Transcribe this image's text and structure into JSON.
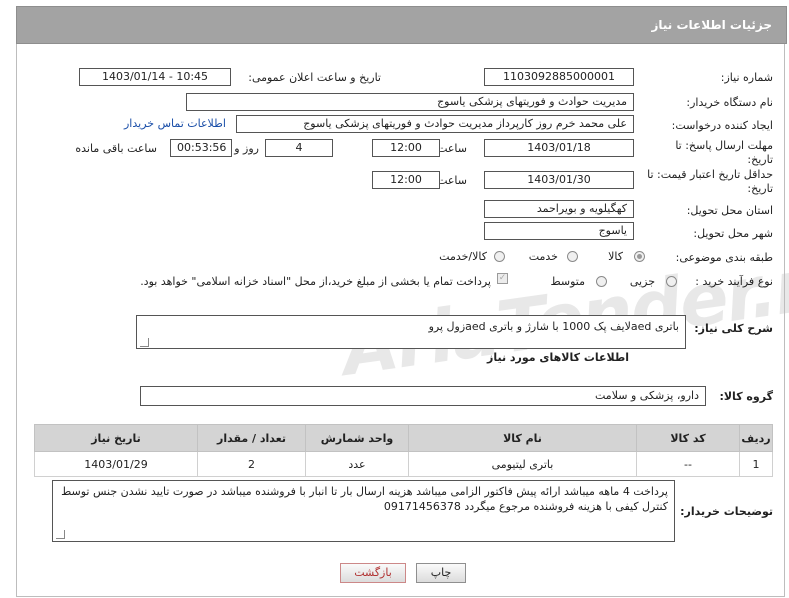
{
  "header": {
    "title": "جزئیات اطلاعات نیاز"
  },
  "form": {
    "need_number_label": "شماره نیاز:",
    "need_number": "1103092885000001",
    "announce_label": "تاریخ و ساعت اعلان عمومی:",
    "announce_value": "1403/01/14 - 10:45",
    "buyer_org_label": "نام دستگاه خریدار:",
    "buyer_org": "مدیریت حوادث و فوریتهای پزشکی یاسوج",
    "creator_label": "ایجاد کننده درخواست:",
    "creator": "علی محمد خرم روز کارپرداز مدیریت حوادث و فوریتهای پزشکی یاسوج",
    "contact_link": "اطلاعات تماس خریدار",
    "reply_deadline_label_1": "مهلت ارسال پاسخ: تا",
    "reply_deadline_label_2": "تاریخ:",
    "reply_date": "1403/01/18",
    "time_label": "ساعت",
    "reply_time": "12:00",
    "days_value": "4",
    "days_label": "روز و",
    "remaining_time": "00:53:56",
    "remaining_label": "ساعت باقی مانده",
    "price_validity_label_1": "حداقل تاریخ اعتبار قیمت: تا",
    "price_validity_label_2": "تاریخ:",
    "price_date": "1403/01/30",
    "price_time_label": "ساعت",
    "price_time": "12:00",
    "province_label": "استان محل تحویل:",
    "province": "کهگیلویه و بویراحمد",
    "city_label": "شهر محل تحویل:",
    "city": "یاسوج",
    "category_label": "طبقه بندی موضوعی:",
    "category_options": [
      "کالا",
      "خدمت",
      "کالا/خدمت"
    ],
    "process_label": "نوع فرآیند خرید :",
    "process_options": [
      "جزیی",
      "متوسط"
    ],
    "payment_note": "پرداخت تمام یا بخشی از مبلغ خرید،از محل \"اسناد خزانه اسلامی\" خواهد بود."
  },
  "general_desc": {
    "label": "شرح کلی نیاز:",
    "value": "باتری aedلایف پک 1000 با شارژ و باتری aedزول پرو"
  },
  "goods_info": {
    "title": "اطلاعات کالاهای مورد نیاز"
  },
  "goods_group": {
    "label": "گروه کالا:",
    "value": "دارو، پزشکی و سلامت"
  },
  "items_table": {
    "headers": [
      "ردیف",
      "کد کالا",
      "نام کالا",
      "واحد شمارش",
      "تعداد / مقدار",
      "تاریخ نیاز"
    ],
    "rows": [
      [
        "1",
        "--",
        "باتری لیتیومی",
        "عدد",
        "2",
        "1403/01/29"
      ]
    ]
  },
  "buyer_notes": {
    "label": "توضیحات خریدار:",
    "value": "پرداخت 4 ماهه میباشد  ارائه پیش فاکتور الزامی میباشد  هزینه ارسال بار تا انبار  با فروشنده میباشد در صورت تایید نشدن جنس توسط کنترل کیفی با  هزینه فروشنده مرجوع میگردد 09171456378"
  },
  "buttons": {
    "print": "چاپ",
    "back": "بازگشت"
  },
  "watermark": "AriaTender.neT"
}
